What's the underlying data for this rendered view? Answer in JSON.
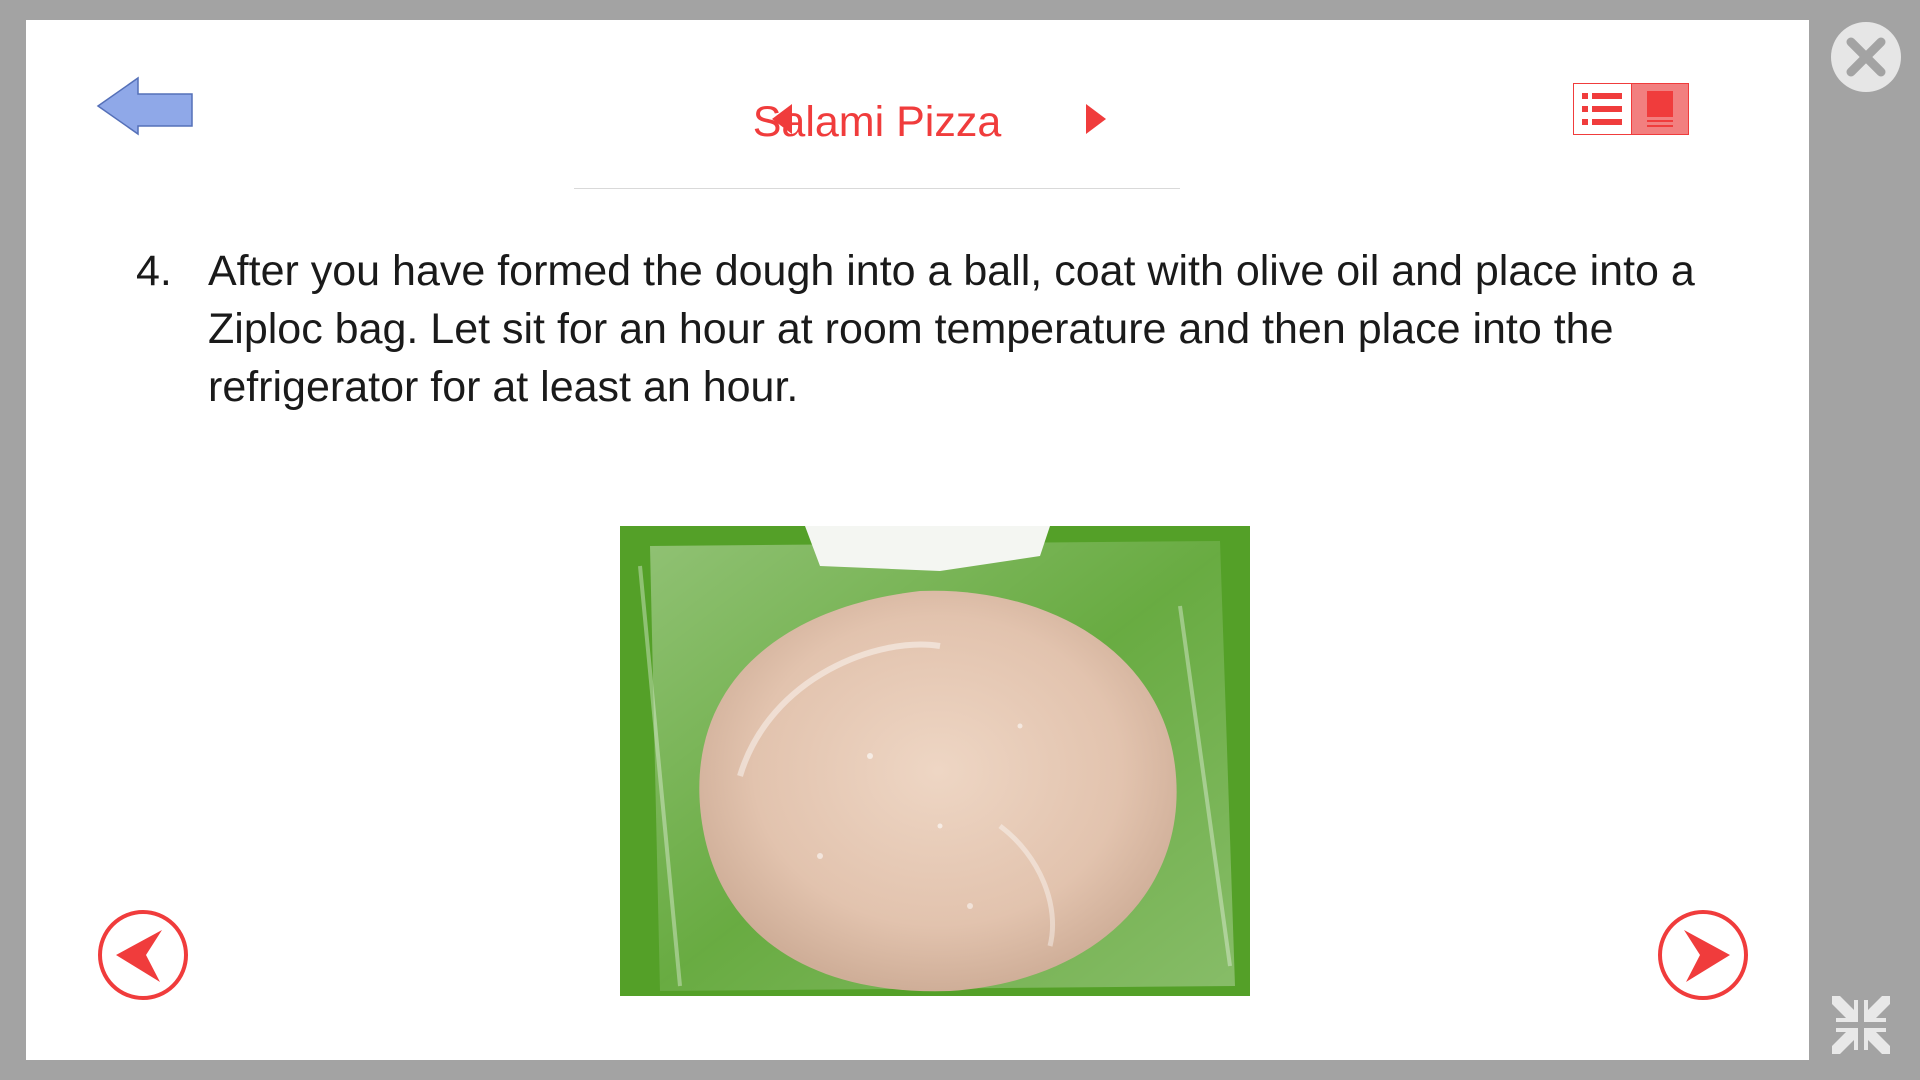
{
  "header": {
    "title": "Salami Pizza",
    "accent_color": "#f03c3c",
    "back_arrow_color": "#8fa8e8",
    "icons": {
      "back": "left-arrow-icon",
      "prev_recipe": "triangle-left-icon",
      "next_recipe": "triangle-right-icon",
      "list_view": "list-view-icon",
      "page_view": "page-view-icon"
    }
  },
  "step": {
    "number": "4.",
    "text": "After you have formed the dough into a ball, coat with olive oil and place into a Ziploc bag. Let sit for an hour at room temperature and then place into the refrigerator for at least an hour."
  },
  "photo": {
    "subject": "dough ball in a plastic bag on green background"
  },
  "navigation": {
    "prev_icon": "circle-chevron-left-icon",
    "next_icon": "circle-chevron-right-icon"
  },
  "window": {
    "close_icon": "close-icon",
    "collapse_icon": "collapse-icon",
    "frame_color": "#a3a3a3"
  }
}
